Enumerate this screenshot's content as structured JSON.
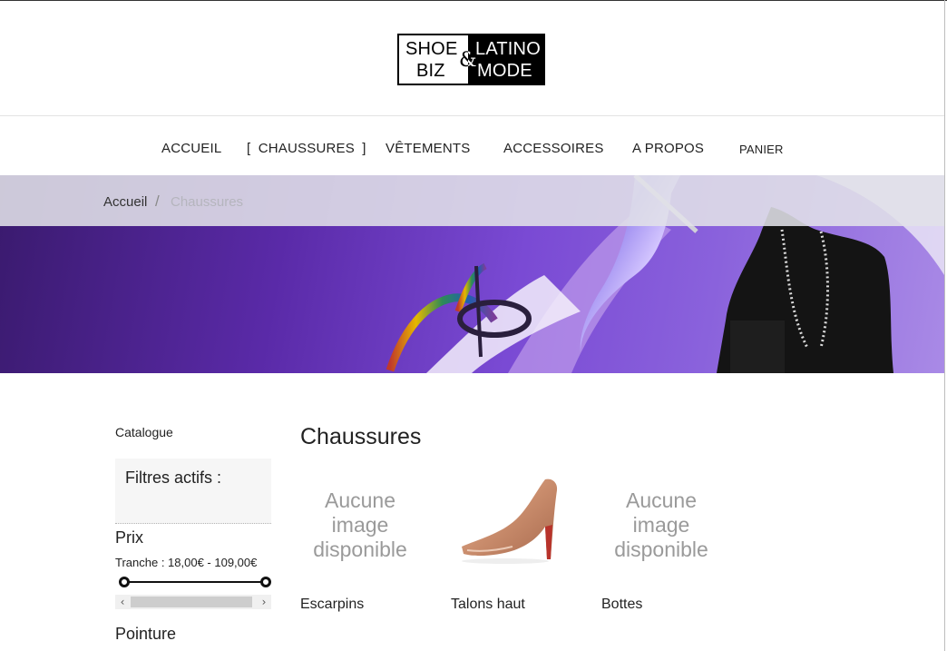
{
  "logo": {
    "left_top": "SHOE",
    "left_bottom": "BIZ",
    "ampersand": "&",
    "right_top": "LATINO",
    "right_bottom": "MODE"
  },
  "nav": {
    "items": [
      {
        "label": "ACCUEIL"
      },
      {
        "label": "[ CHAUSSURES ]"
      },
      {
        "label": "VÊTEMENTS"
      },
      {
        "label": "ACCESSOIRES"
      },
      {
        "label": "A PROPOS"
      },
      {
        "label": "PANIER"
      }
    ]
  },
  "breadcrumb": {
    "home": "Accueil",
    "separator": "/",
    "current": "Chaussures"
  },
  "sidebar": {
    "title": "Catalogue",
    "active_filters": "Filtres actifs :",
    "price": {
      "title": "Prix",
      "range": "Tranche : 18,00€ - 109,00€",
      "min_fraction": 0,
      "max_fraction": 1
    },
    "size_title": "Pointure",
    "scroll": {
      "left": "‹",
      "right": "›"
    }
  },
  "main": {
    "title": "Chaussures",
    "no_image_text": [
      "Aucune",
      "image",
      "disponible"
    ],
    "products": [
      {
        "name": "Escarpins",
        "image": "no-image"
      },
      {
        "name": "Talons haut",
        "image": "nude-pump"
      },
      {
        "name": "Bottes",
        "image": "no-image"
      }
    ]
  },
  "colors": {
    "banner_purple": "#7a4ad4",
    "text": "#222222",
    "breadcrumb_muted": "#b5b5bd"
  }
}
